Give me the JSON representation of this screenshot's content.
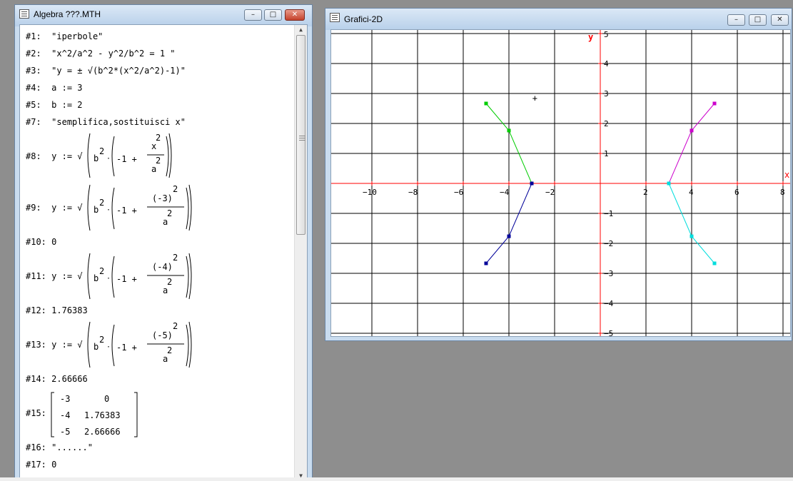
{
  "algebra_window": {
    "title": "Algebra ???.MTH",
    "controls": {
      "min": "–",
      "max": "□",
      "close": "✕"
    },
    "lines": [
      {
        "num": "#1:",
        "text": "\"iperbole\""
      },
      {
        "num": "#2:",
        "text": "\"x^2/a^2 - y^2/b^2 = 1 \""
      },
      {
        "num": "#3:",
        "text": "\"y = ± √(b^2*(x^2/a^2)-1)\""
      },
      {
        "num": "#4:",
        "text": "a := 3"
      },
      {
        "num": "#5:",
        "text": "b := 2"
      },
      {
        "num": "#7:",
        "text": "\"semplifica,sostituisci x\""
      },
      {
        "num": "#8:",
        "text": "y := √"
      },
      {
        "num": "#9:",
        "text": "y := √"
      },
      {
        "num": "#10:",
        "text": "0"
      },
      {
        "num": "#11:",
        "text": "y := √"
      },
      {
        "num": "#12:",
        "text": "1.76383"
      },
      {
        "num": "#13:",
        "text": "y := √"
      },
      {
        "num": "#14:",
        "text": "2.66666"
      },
      {
        "num": "#15:",
        "text": ""
      },
      {
        "num": "#16:",
        "text": "\"......\""
      },
      {
        "num": "#17:",
        "text": "0"
      }
    ],
    "formula_parts": {
      "b": "b",
      "sq": "2",
      "minus_one": "-1 +",
      "x": "x",
      "a": "a",
      "num9": "(-3)",
      "num11": "(-4)",
      "num13": "(-5)"
    },
    "matrix": [
      [
        "-3",
        "0"
      ],
      [
        "-4",
        "1.76383"
      ],
      [
        "-5",
        "2.66666"
      ]
    ]
  },
  "plot_window": {
    "title": "Grafici-2D",
    "controls": {
      "min": "–",
      "max": "□",
      "close": "✕"
    },
    "axis_label_x": "x",
    "axis_label_y": "y",
    "cursor_glyph": "+"
  },
  "colors": {
    "axis": "#ff0000",
    "green": "#00cc00",
    "blue": "#000099",
    "magenta": "#cc00cc",
    "cyan": "#00dddd"
  },
  "chart_data": {
    "type": "line",
    "xlabel": "x",
    "ylabel": "y",
    "xlim": [
      -11.5,
      8
    ],
    "ylim": [
      -5,
      5
    ],
    "x_ticks": [
      -10,
      -8,
      -6,
      -4,
      -2,
      2,
      4,
      6,
      8
    ],
    "y_ticks": [
      -5,
      -4,
      -3,
      -2,
      -1,
      1,
      2,
      3,
      4,
      5
    ],
    "grid": true,
    "series": [
      {
        "color": "green",
        "points": [
          [
            -5,
            2.66666
          ],
          [
            -4,
            1.76383
          ],
          [
            -3,
            0
          ]
        ]
      },
      {
        "color": "blue",
        "points": [
          [
            -3,
            0
          ],
          [
            -4,
            -1.76383
          ],
          [
            -5,
            -2.66666
          ]
        ]
      },
      {
        "color": "magenta",
        "points": [
          [
            3,
            0
          ],
          [
            4,
            1.76383
          ],
          [
            5,
            2.66666
          ]
        ]
      },
      {
        "color": "cyan",
        "points": [
          [
            3,
            0
          ],
          [
            4,
            -1.76383
          ],
          [
            5,
            -2.66666
          ]
        ]
      }
    ]
  }
}
